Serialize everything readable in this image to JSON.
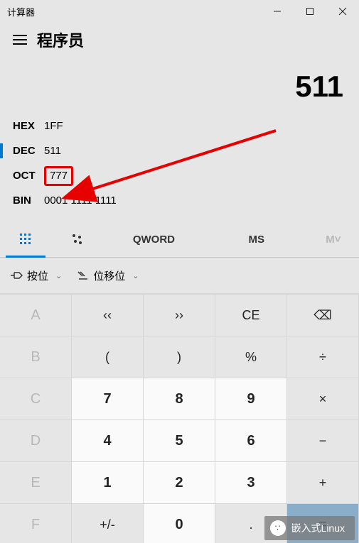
{
  "window": {
    "title": "计算器"
  },
  "header": {
    "mode": "程序员"
  },
  "display": {
    "value": "511"
  },
  "bases": {
    "hex": {
      "label": "HEX",
      "value": "1FF"
    },
    "dec": {
      "label": "DEC",
      "value": "511"
    },
    "oct": {
      "label": "OCT",
      "value": "777"
    },
    "bin": {
      "label": "BIN",
      "value": "0001 1111 1111"
    }
  },
  "tabs": {
    "keypad": "",
    "bits": "",
    "word": "QWORD",
    "ms": "MS",
    "mmenu": "M˅"
  },
  "bitops": {
    "bitwise": "按位",
    "shift": "位移位"
  },
  "keys": {
    "a": "A",
    "lsh": "‹‹",
    "rsh": "››",
    "ce": "CE",
    "bksp": "⌫",
    "b": "B",
    "lparen": "(",
    "rparen": ")",
    "pct": "%",
    "div": "÷",
    "c": "C",
    "k7": "7",
    "k8": "8",
    "k9": "9",
    "mul": "×",
    "d": "D",
    "k4": "4",
    "k5": "5",
    "k6": "6",
    "sub": "−",
    "e": "E",
    "k1": "1",
    "k2": "2",
    "k3": "3",
    "add": "+",
    "f": "F",
    "neg": "+/-",
    "k0": "0",
    "dot": ".",
    "eq": "="
  },
  "footer": {
    "label": "嵌入式Linux"
  },
  "colors": {
    "accent": "#0078d4",
    "annotation": "#e60000"
  }
}
